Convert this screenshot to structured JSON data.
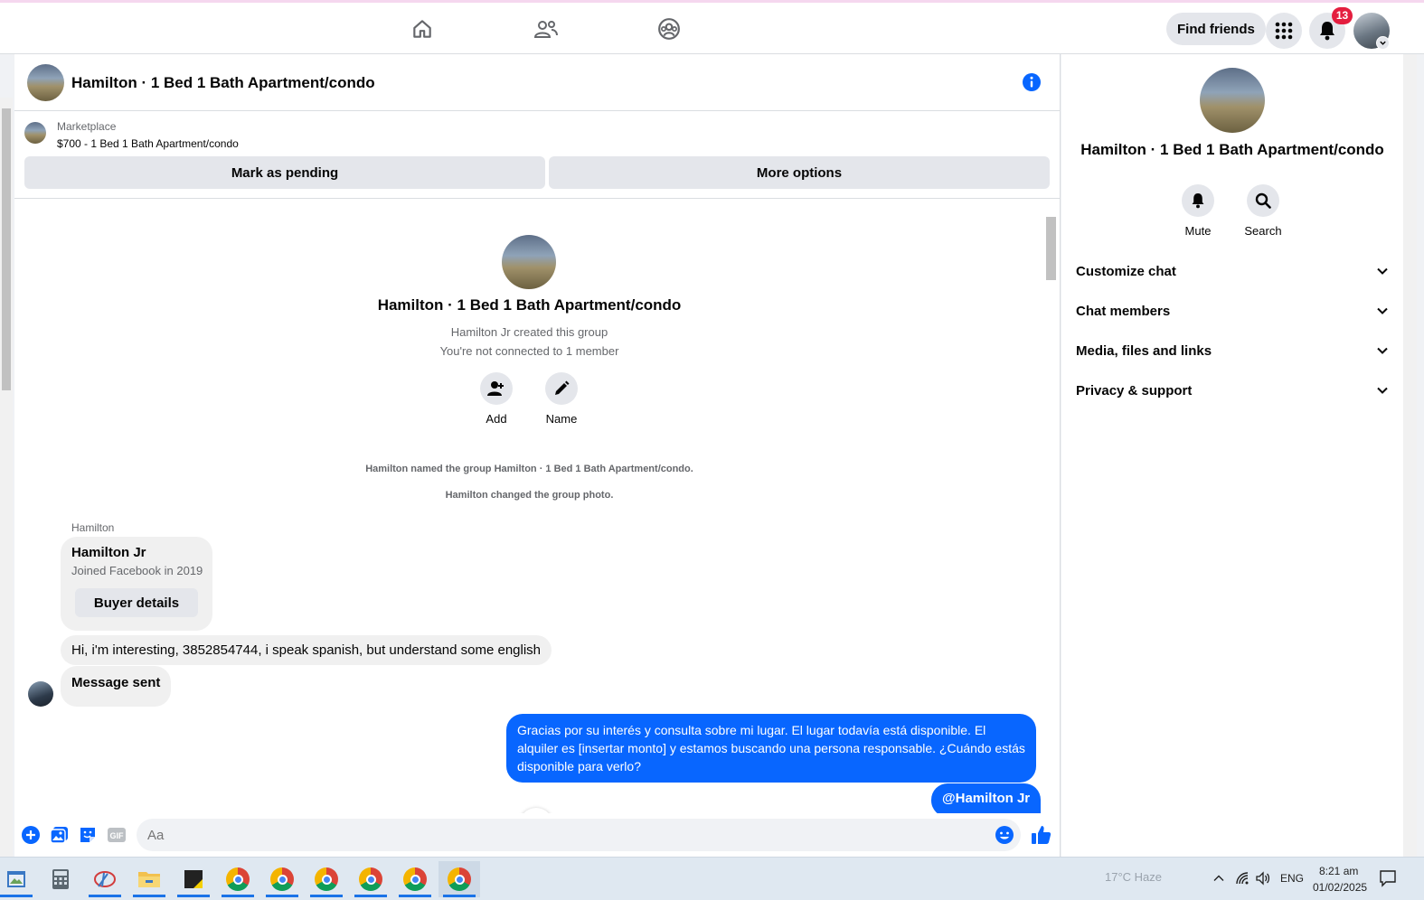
{
  "topbar": {
    "find_friends_label": "Find friends",
    "notification_count": "13"
  },
  "chat": {
    "title": "Hamilton · 1 Bed 1 Bath Apartment/condo",
    "marketplace": {
      "source": "Marketplace",
      "listing": "$700 - 1 Bed 1 Bath Apartment/condo",
      "mark_pending": "Mark as pending",
      "more_options": "More options"
    },
    "intro": {
      "title": "Hamilton · 1 Bed 1 Bath Apartment/condo",
      "created_by": "Hamilton Jr created this group",
      "connection_note": "You're not connected to 1 member",
      "add_label": "Add",
      "name_label": "Name"
    },
    "system_notes": [
      "Hamilton named the group Hamilton · 1 Bed 1 Bath Apartment/condo.",
      "Hamilton changed the group photo."
    ],
    "sender_name": "Hamilton",
    "buyer_card": {
      "name": "Hamilton Jr",
      "joined": "Joined Facebook in 2019",
      "button": "Buyer details"
    },
    "incoming": [
      "Hi, i'm interesting, 3852854744, i speak spanish, but understand some english",
      "Message sent"
    ],
    "outgoing": "Gracias por su interés y consulta sobre mi lugar. El lugar todavía está disponible. El alquiler es [insertar monto] y estamos buscando una persona responsable. ¿Cuándo estás disponible para verlo?",
    "outgoing_mention": "@Hamilton Jr",
    "composer_placeholder": "Aa"
  },
  "info_panel": {
    "title": "Hamilton · 1 Bed 1 Bath Apartment/condo",
    "mute_label": "Mute",
    "search_label": "Search",
    "sections": [
      "Customize chat",
      "Chat members",
      "Media, files and links",
      "Privacy & support"
    ]
  },
  "taskbar": {
    "weather": "17°C  Haze",
    "language": "ENG",
    "time": "8:21 am",
    "date": "01/02/2025"
  },
  "colors": {
    "accent": "#0866ff",
    "badge": "#e41e3f",
    "button_bg": "#e4e6eb",
    "bubble_in": "#f0f0f0"
  }
}
